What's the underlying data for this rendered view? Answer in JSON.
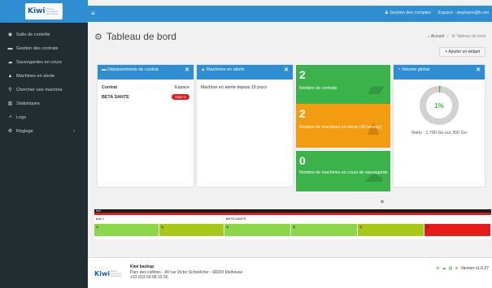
{
  "brand": {
    "logo_text": "Kiwi",
    "logo_tagline": "Backup Sauvegarde Externalisée"
  },
  "sidebar": {
    "items": [
      {
        "label": "Salle de contrôle",
        "icon": "dashboard-icon"
      },
      {
        "label": "Gestion des contrats",
        "icon": "folder-icon"
      },
      {
        "label": "Sauvegardes en cours",
        "icon": "cloud-icon"
      },
      {
        "label": "Machines en alerte",
        "icon": "warning-icon"
      },
      {
        "label": "Chercher une machine",
        "icon": "search-icon"
      },
      {
        "label": "Statistiques",
        "icon": "bar-chart-icon"
      },
      {
        "label": "Logs",
        "icon": "line-chart-icon"
      },
      {
        "label": "Réglage",
        "icon": "cogs-icon",
        "caret": "‹"
      }
    ]
  },
  "topbar": {
    "hamburger": "≡",
    "manage_accounts": "♟ Gestion des comptes",
    "space": "Espace : stephane@b.net"
  },
  "header": {
    "title": "Tableau de bord",
    "breadcrumb_home": "Accueil",
    "breadcrumb_sep": "/",
    "breadcrumb_current": "Tableau de bord",
    "add_widget": "+ Ajouter un widget"
  },
  "widgets": {
    "contracts": {
      "title": "Dépassements de contrat",
      "col_contract": "Contrat",
      "col_space": "Espace",
      "rows": [
        {
          "contract": "BETA SANTE",
          "badge": "5464 %"
        }
      ]
    },
    "alerts": {
      "title": "Machines en alerte",
      "body": "Machine en alerte depuis 15 jours"
    },
    "tile_contracts": {
      "number": "2",
      "label": "Nombre de contrats",
      "color": "#3bb34a"
    },
    "tile_alerts": {
      "number": "2",
      "label": "Nombre de machines en alerte (48 heures)",
      "color": "#f39c12"
    },
    "tile_backups": {
      "number": "0",
      "label": "Nombre de machines en cours de sauvegarde",
      "color": "#3bb34a"
    },
    "volume": {
      "title": "Volume global",
      "percent_text": "1%",
      "percent_value": 1,
      "ratio": "Ratio : 1.790 Go sur 300 Go"
    }
  },
  "close_label": "×",
  "bars": {
    "title": "test",
    "groups": [
      {
        "label": "test 2",
        "segments": [
          {
            "value": "9j",
            "color": "#8cd64a"
          },
          {
            "value": "9j",
            "color": "#a8c91a"
          }
        ]
      },
      {
        "label": "BETA SANTE",
        "segments": [
          {
            "value": "9j",
            "color": "#8cd64a"
          },
          {
            "value": "9j",
            "color": "#8cd64a"
          },
          {
            "value": "9j",
            "color": "#a8c91a"
          },
          {
            "value": "9j",
            "color": "#e81b1b"
          }
        ]
      }
    ]
  },
  "footer": {
    "company": "Kiwi backup",
    "address": "Parc des collines - 40 rue Victor Schoelcher - 68200 Mulhouse",
    "phone": "+33 (0)3 69 08 15 50",
    "version": "Version v1.0.27"
  }
}
